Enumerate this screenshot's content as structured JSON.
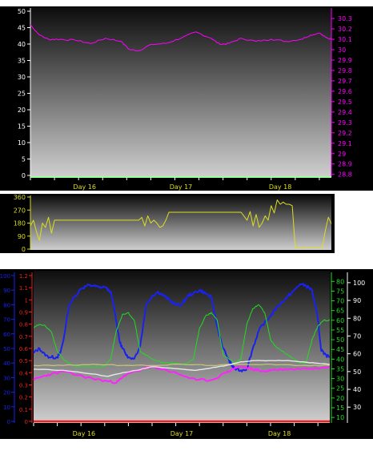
{
  "colors": {
    "panel_bg": "#000000",
    "grad_top": "#111111",
    "grad_bottom": "#c8c8c8",
    "axis_white": "#ffffff",
    "magenta": "#ff00ff",
    "yellow": "#dddd22",
    "blue": "#1a22ee",
    "green": "#22dd22",
    "red": "#ee2222",
    "pink": "#ff22ff",
    "khaki": "#c8c87a",
    "lightgray": "#e8e8e8",
    "palegreen": "#99ff99"
  },
  "chart_data": [
    {
      "type": "line",
      "panel": "top",
      "x_tick_labels": [
        "Day 16",
        "Day 17",
        "Day 18"
      ],
      "xlim": [
        0,
        100
      ],
      "left_axis": {
        "ticks": [
          "0",
          "5",
          "10",
          "15",
          "20",
          "25",
          "30",
          "35",
          "40",
          "45",
          "50"
        ],
        "ylim": [
          0,
          50
        ]
      },
      "right_axis": {
        "ticks": [
          "28.8",
          "28.9",
          "29",
          "29.1",
          "29.2",
          "29.3",
          "29.4",
          "29.5",
          "29.6",
          "29.7",
          "29.8",
          "29.9",
          "30",
          "30.1",
          "30.2",
          "30.3"
        ],
        "ylim": [
          28.79,
          30.37
        ]
      },
      "series": [
        {
          "axis": "right",
          "color": "magenta",
          "x": [
            0,
            3,
            6,
            10,
            15,
            20,
            25,
            30,
            33,
            36,
            40,
            45,
            50,
            55,
            60,
            63,
            66,
            70,
            75,
            80,
            85,
            90,
            93,
            96,
            98,
            100
          ],
          "values": [
            30.24,
            30.14,
            30.1,
            30.1,
            30.09,
            30.06,
            30.11,
            30.08,
            30.0,
            29.99,
            30.05,
            30.06,
            30.11,
            30.17,
            30.11,
            30.05,
            30.06,
            30.11,
            30.08,
            30.1,
            30.08,
            30.1,
            30.14,
            30.16,
            30.12,
            30.1
          ]
        }
      ]
    },
    {
      "type": "line",
      "panel": "middle",
      "xlim": [
        0,
        100
      ],
      "left_axis": {
        "ticks": [
          "0",
          "90",
          "180",
          "270",
          "360"
        ],
        "ylim": [
          0,
          360
        ]
      },
      "series": [
        {
          "axis": "left",
          "color": "yellow",
          "x": [
            0,
            1,
            2,
            3,
            4,
            5,
            6,
            7,
            8,
            10,
            12,
            14,
            16,
            18,
            20,
            22,
            24,
            26,
            28,
            30,
            32,
            34,
            36,
            37,
            38,
            39,
            40,
            41,
            42,
            43,
            44,
            45,
            46,
            50,
            55,
            60,
            65,
            70,
            72,
            73,
            74,
            75,
            76,
            77,
            78,
            79,
            80,
            81,
            82,
            83,
            84,
            85,
            86,
            87,
            88,
            90,
            92,
            94,
            96,
            97,
            98,
            99,
            100
          ],
          "values": [
            160,
            200,
            120,
            60,
            180,
            150,
            220,
            110,
            200,
            200,
            200,
            200,
            200,
            200,
            200,
            200,
            200,
            200,
            200,
            200,
            200,
            200,
            200,
            220,
            160,
            230,
            180,
            200,
            180,
            150,
            160,
            200,
            255,
            255,
            255,
            255,
            255,
            255,
            200,
            260,
            160,
            240,
            150,
            180,
            230,
            200,
            300,
            250,
            340,
            310,
            325,
            310,
            310,
            300,
            10,
            10,
            10,
            10,
            10,
            10,
            130,
            220,
            175
          ]
        }
      ]
    },
    {
      "type": "line",
      "panel": "bottom",
      "x_tick_labels": [
        "Day 16",
        "Day 17",
        "Day 18"
      ],
      "xlim": [
        0,
        100
      ],
      "axis_blue": {
        "ticks": [
          "0",
          "10",
          "20",
          "30",
          "40",
          "50",
          "60",
          "70",
          "80",
          "90",
          "100"
        ],
        "ylim": [
          0,
          100
        ]
      },
      "axis_red": {
        "ticks": [
          "0",
          "0.1",
          "0.2",
          "0.3",
          "0.4",
          "0.5",
          "0.6",
          "0.7",
          "0.8",
          "0.9",
          "1",
          "1.1",
          "1.2"
        ],
        "ylim": [
          0,
          1.2
        ]
      },
      "axis_green": {
        "ticks": [
          "10",
          "15",
          "20",
          "25",
          "30",
          "35",
          "40",
          "45",
          "50",
          "55",
          "60",
          "65",
          "70",
          "75",
          "80"
        ],
        "ylim": [
          8,
          83
        ]
      },
      "axis_gray": {
        "ticks": [
          "30",
          "40",
          "50",
          "60",
          "70",
          "80",
          "90",
          "100"
        ],
        "ylim": [
          22,
          104
        ]
      },
      "series": [
        {
          "axis": "blue",
          "color": "blue",
          "x": [
            0,
            2,
            4,
            6,
            8,
            9,
            10,
            12,
            14,
            16,
            18,
            20,
            22,
            24,
            26,
            27,
            28,
            29,
            30,
            31,
            32,
            34,
            36,
            38,
            40,
            42,
            44,
            46,
            48,
            50,
            52,
            54,
            56,
            58,
            60,
            62,
            64,
            66,
            67,
            68,
            70,
            72,
            74,
            76,
            78,
            80,
            82,
            84,
            86,
            88,
            90,
            92,
            94,
            96,
            97,
            98,
            100
          ],
          "values": [
            47,
            50,
            45,
            44,
            44,
            47,
            55,
            80,
            86,
            91,
            93,
            93,
            92,
            92,
            89,
            80,
            68,
            55,
            50,
            47,
            44,
            43,
            52,
            80,
            86,
            89,
            86,
            83,
            80,
            80,
            86,
            88,
            90,
            88,
            85,
            65,
            50,
            42,
            38,
            36,
            35,
            36,
            50,
            62,
            68,
            72,
            78,
            82,
            86,
            90,
            94,
            93,
            90,
            70,
            50,
            46,
            44
          ]
        },
        {
          "axis": "green",
          "color": "green",
          "x": [
            0,
            2,
            4,
            6,
            8,
            10,
            12,
            14,
            16,
            18,
            20,
            22,
            24,
            26,
            28,
            30,
            32,
            34,
            36,
            38,
            40,
            42,
            44,
            46,
            48,
            50,
            52,
            54,
            56,
            58,
            60,
            62,
            64,
            66,
            68,
            70,
            72,
            74,
            76,
            78,
            80,
            82,
            84,
            86,
            88,
            90,
            92,
            94,
            96,
            98,
            100
          ],
          "values": [
            56,
            58,
            57,
            54,
            44,
            40,
            38,
            36,
            36,
            36,
            36,
            36,
            36,
            40,
            55,
            63,
            64,
            60,
            44,
            42,
            40,
            39,
            38,
            38,
            38,
            37,
            38,
            40,
            56,
            62,
            64,
            60,
            42,
            40,
            38,
            40,
            58,
            66,
            68,
            64,
            50,
            46,
            44,
            42,
            40,
            38,
            38,
            50,
            57,
            60,
            60
          ]
        },
        {
          "axis": "red",
          "color": "pink",
          "x": [
            0,
            3,
            6,
            10,
            15,
            20,
            25,
            28,
            30,
            32,
            34,
            36,
            38,
            40,
            45,
            50,
            55,
            60,
            65,
            68,
            70,
            72,
            74,
            76,
            78,
            80,
            85,
            90,
            95,
            100
          ],
          "values": [
            0.34,
            0.37,
            0.39,
            0.41,
            0.38,
            0.35,
            0.33,
            0.32,
            0.36,
            0.4,
            0.41,
            0.42,
            0.44,
            0.45,
            0.42,
            0.38,
            0.34,
            0.34,
            0.4,
            0.44,
            0.45,
            0.44,
            0.43,
            0.42,
            0.41,
            0.42,
            0.43,
            0.43,
            0.44,
            0.45
          ]
        },
        {
          "axis": "red",
          "color": "khaki",
          "x": [
            0,
            10,
            20,
            30,
            40,
            50,
            60,
            70,
            80,
            90,
            100
          ],
          "values": [
            0.46,
            0.46,
            0.47,
            0.46,
            0.46,
            0.47,
            0.46,
            0.47,
            0.47,
            0.46,
            0.46
          ]
        },
        {
          "axis": "red",
          "color": "lightgray",
          "x": [
            0,
            10,
            20,
            25,
            30,
            35,
            40,
            45,
            50,
            55,
            60,
            65,
            70,
            75,
            80,
            85,
            90,
            95,
            100
          ],
          "values": [
            0.43,
            0.42,
            0.39,
            0.37,
            0.4,
            0.42,
            0.45,
            0.44,
            0.43,
            0.42,
            0.44,
            0.46,
            0.49,
            0.5,
            0.5,
            0.5,
            0.49,
            0.48,
            0.47
          ]
        },
        {
          "axis": "red",
          "color": "red",
          "x": [
            0,
            100
          ],
          "values": [
            0.0,
            0.0
          ]
        }
      ]
    }
  ]
}
